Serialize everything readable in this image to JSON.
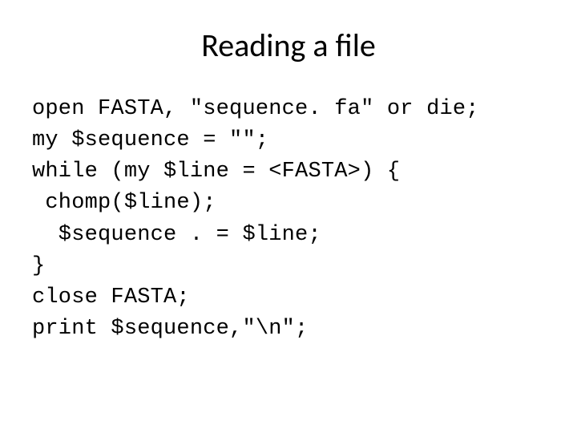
{
  "slide": {
    "title": "Reading  a file",
    "code_lines": {
      "l0": "open FASTA, \"sequence. fa\" or die;",
      "l1": "my $sequence = \"\";",
      "l2": "while (my $line = <FASTA>) {",
      "l3": " chomp($line);",
      "l4": "  $sequence . = $line;",
      "l5": "}",
      "l6": "close FASTA;",
      "l7": "print $sequence,\"\\n\";"
    }
  }
}
